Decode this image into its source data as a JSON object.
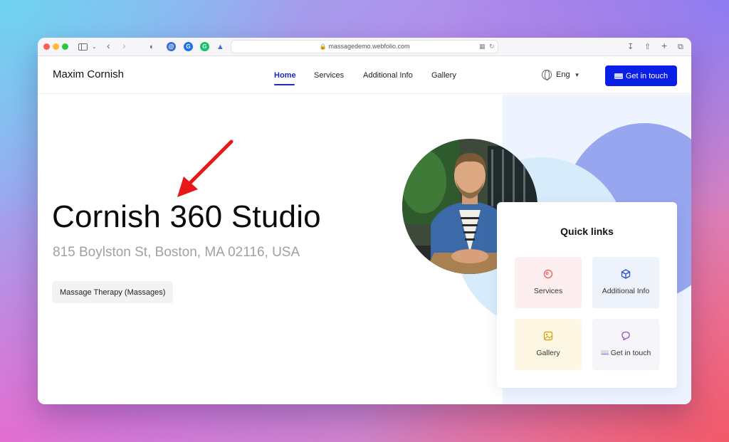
{
  "browser": {
    "url": "massagedemo.webfolio.com"
  },
  "site": {
    "brand": "Maxim Cornish",
    "nav": [
      {
        "label": "Home"
      },
      {
        "label": "Services"
      },
      {
        "label": "Additional Info"
      },
      {
        "label": "Gallery"
      }
    ],
    "language": "Eng",
    "cta_label": "Get in touch"
  },
  "hero": {
    "title": "Cornish 360 Studio",
    "address": "815 Boylston St, Boston, MA 02116, USA",
    "tag": "Massage Therapy (Massages)"
  },
  "quick_links": {
    "title": "Quick links",
    "items": [
      {
        "label": "Services",
        "icon": "services-icon",
        "color": "#e06a6a"
      },
      {
        "label": "Additional Info",
        "icon": "cube-icon",
        "color": "#2a4fd0"
      },
      {
        "label": "Gallery",
        "icon": "image-icon",
        "color": "#d9a520"
      },
      {
        "label": "Get in touch",
        "icon": "chat-icon",
        "color": "#9b4fc0"
      }
    ]
  },
  "colors": {
    "accent": "#0a1fe6",
    "annotation_arrow": "#e81818"
  }
}
